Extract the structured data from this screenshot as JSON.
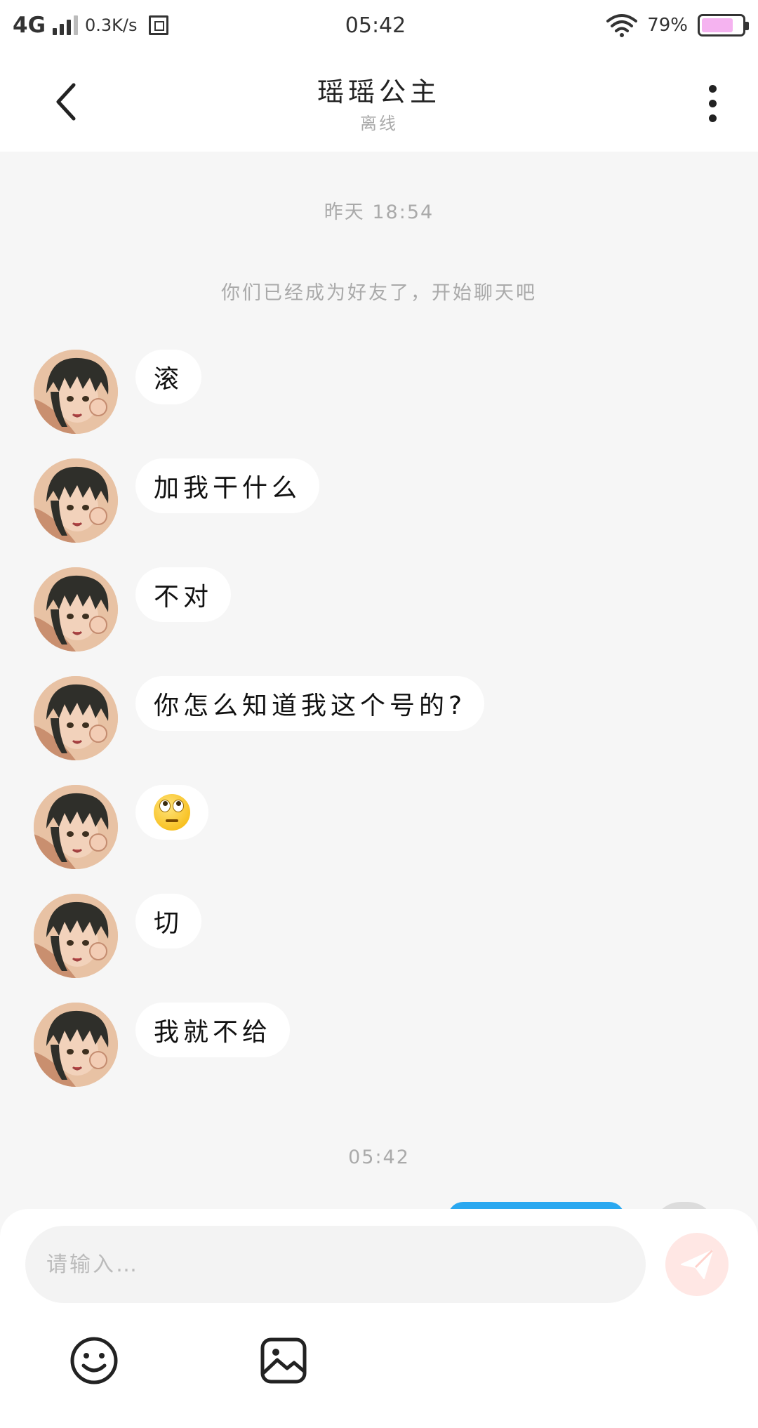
{
  "status_bar": {
    "network": "4G",
    "speed": "0.3K/s",
    "time": "05:42",
    "battery_percent": "79%",
    "battery_level": 0.79
  },
  "header": {
    "title": "瑶瑶公主",
    "subtitle": "离线"
  },
  "chat": {
    "timestamp_1": "昨天 18:54",
    "system_message": "你们已经成为好友了，开始聊天吧",
    "messages": [
      {
        "type": "text",
        "text": "滚"
      },
      {
        "type": "text",
        "text": "加我干什么"
      },
      {
        "type": "text",
        "text": "不对"
      },
      {
        "type": "text",
        "text": "你怎么知道我这个号的?"
      },
      {
        "type": "emoji",
        "icon": "face-with-rolling-eyes-icon"
      },
      {
        "type": "text",
        "text": "切"
      },
      {
        "type": "text",
        "text": "我就不给"
      }
    ],
    "timestamp_2": "05:42"
  },
  "composer": {
    "placeholder": "请输入…",
    "value": ""
  },
  "icons": {
    "back": "back-arrow-icon",
    "more": "more-vertical-icon",
    "send": "send-icon",
    "emoji": "smiley-icon",
    "image": "image-icon"
  },
  "colors": {
    "background": "#f6f6f6",
    "bubble": "#ffffff",
    "sent_bubble": "#2aa8f0",
    "send_button": "#ffe7e4",
    "battery": "#f5b3f0"
  }
}
